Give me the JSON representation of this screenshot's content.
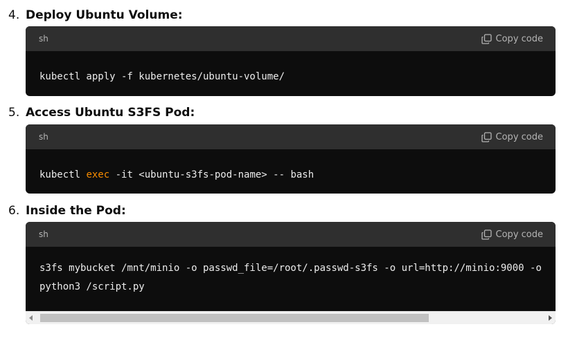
{
  "steps": [
    {
      "number": "4.",
      "title": "Deploy Ubuntu Volume:",
      "lang": "sh",
      "copy_label": "Copy code",
      "code_parts": [
        {
          "text": "kubectl apply -f kubernetes/ubuntu-volume/"
        }
      ]
    },
    {
      "number": "5.",
      "title": "Access Ubuntu S3FS Pod:",
      "lang": "sh",
      "copy_label": "Copy code",
      "code_parts": [
        {
          "text": "kubectl "
        },
        {
          "text": "exec",
          "keyword": true
        },
        {
          "text": " -it <ubuntu-s3fs-pod-name> -- bash"
        }
      ]
    },
    {
      "number": "6.",
      "title": "Inside the Pod:",
      "lang": "sh",
      "copy_label": "Copy code",
      "code_lines": [
        "s3fs mybucket /mnt/minio -o passwd_file=/root/.passwd-s3fs -o url=http://minio:9000 -o",
        "python3 /script.py"
      ]
    }
  ],
  "colors": {
    "keyword": "#f78c00",
    "code_bg": "#0d0d0d",
    "header_bg": "#2f2f2f"
  },
  "icons": {
    "copy": "copy-icon"
  }
}
